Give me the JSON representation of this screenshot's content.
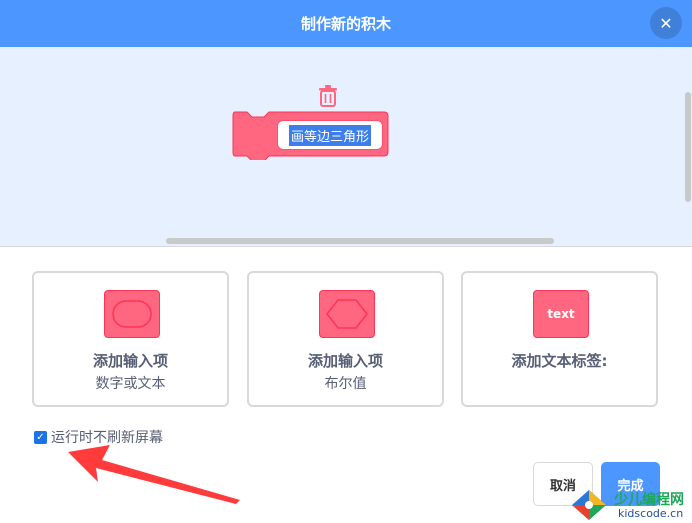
{
  "dialog": {
    "title": "制作新的积木",
    "close_icon": "close-icon"
  },
  "workspace": {
    "block_name": "画等边三角形",
    "block_color": "#ff6680",
    "trash_icon": "trash-icon"
  },
  "options": [
    {
      "title": "添加输入项",
      "subtitle": "数字或文本",
      "icon": "round-input-icon"
    },
    {
      "title": "添加输入项",
      "subtitle": "布尔值",
      "icon": "boolean-input-icon"
    },
    {
      "title": "添加文本标签:",
      "subtitle": "",
      "icon": "text-label-icon",
      "icon_text": "text"
    }
  ],
  "run_without_refresh": {
    "label": "运行时不刷新屏幕",
    "checked": true
  },
  "footer": {
    "cancel_label": "取消",
    "ok_label": "完成"
  },
  "watermark": {
    "cn": "少儿编程网",
    "en": "kidscode.cn"
  },
  "colors": {
    "header": "#4c97ff",
    "workspace_bg": "#e6f0ff",
    "block": "#ff6680",
    "arrow": "#ff3b3b"
  }
}
